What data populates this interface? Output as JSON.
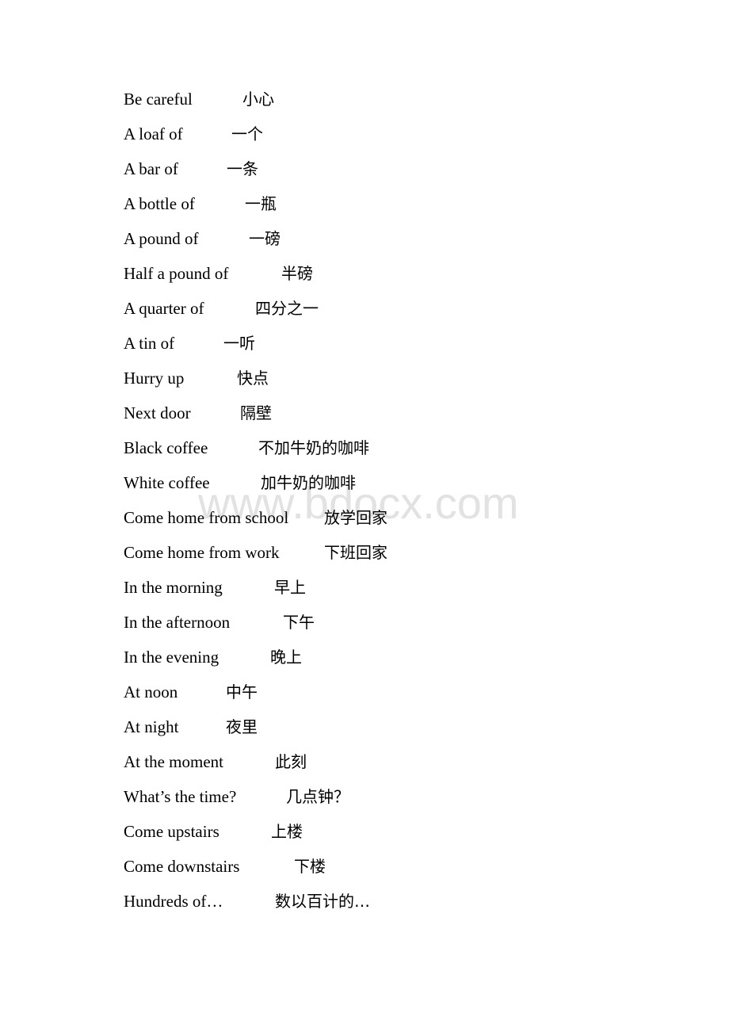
{
  "watermark": "www.bdocx.com",
  "phrases": [
    {
      "en": "Be careful",
      "zh": "小心",
      "gap": 54
    },
    {
      "en": "A loaf of",
      "zh": "一个",
      "gap": 52
    },
    {
      "en": "A bar of",
      "zh": "一条",
      "gap": 52
    },
    {
      "en": "A bottle of",
      "zh": "一瓶",
      "gap": 52
    },
    {
      "en": "A pound of",
      "zh": "一磅",
      "gap": 52
    },
    {
      "en": "Half a pound of",
      "zh": "半磅",
      "gap": 52
    },
    {
      "en": "A quarter of",
      "zh": "四分之一",
      "gap": 52
    },
    {
      "en": "A tin of",
      "zh": "一听",
      "gap": 52
    },
    {
      "en": "Hurry up",
      "zh": "快点",
      "gap": 58
    },
    {
      "en": "Next door",
      "zh": "隔壁",
      "gap": 54
    },
    {
      "en": "Black coffee",
      "zh": "不加牛奶的咖啡",
      "gap": 52
    },
    {
      "en": "White coffee",
      "zh": "加牛奶的咖啡",
      "gap": 52
    },
    {
      "en": "Come home from school",
      "zh": "放学回家",
      "gap": 24
    },
    {
      "en": "Come home from work",
      "zh": "下班回家",
      "gap": 36
    },
    {
      "en": "In the morning",
      "zh": "早上",
      "gap": 52
    },
    {
      "en": "In the afternoon",
      "zh": "下午",
      "gap": 52
    },
    {
      "en": "In the evening",
      "zh": "晚上",
      "gap": 52
    },
    {
      "en": "At noon",
      "zh": "中午",
      "gap": 52
    },
    {
      "en": "At night",
      "zh": "夜里",
      "gap": 52
    },
    {
      "en": "At the moment",
      "zh": "此刻",
      "gap": 52
    },
    {
      "en": "What’s the time?",
      "zh": "几点钟？",
      "gap": 46
    },
    {
      "en": "Come upstairs",
      "zh": "上楼",
      "gap": 52
    },
    {
      "en": "Come downstairs",
      "zh": "下楼",
      "gap": 52
    },
    {
      "en": "Hundreds of…",
      "zh": "数以百计的…",
      "gap": 52
    }
  ]
}
